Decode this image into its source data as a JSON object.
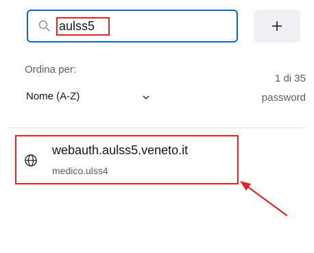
{
  "search": {
    "value": "aulss5",
    "icon": "search-icon"
  },
  "add_button": {
    "label": "+",
    "icon": "plus-icon"
  },
  "sort": {
    "label": "Ordina per:",
    "selected": "Nome (A-Z)",
    "icon": "chevron-down-icon"
  },
  "count": {
    "line1": "1 di 35",
    "line2": "password"
  },
  "logins": [
    {
      "title": "webauth.aulss5.veneto.it",
      "username": "medico.ulss4",
      "icon": "globe-icon"
    }
  ],
  "colors": {
    "focus_border": "#0a66d8",
    "highlight": "#e02424",
    "secondary_text": "#5b5b66",
    "button_bg": "#f0f0f4"
  }
}
